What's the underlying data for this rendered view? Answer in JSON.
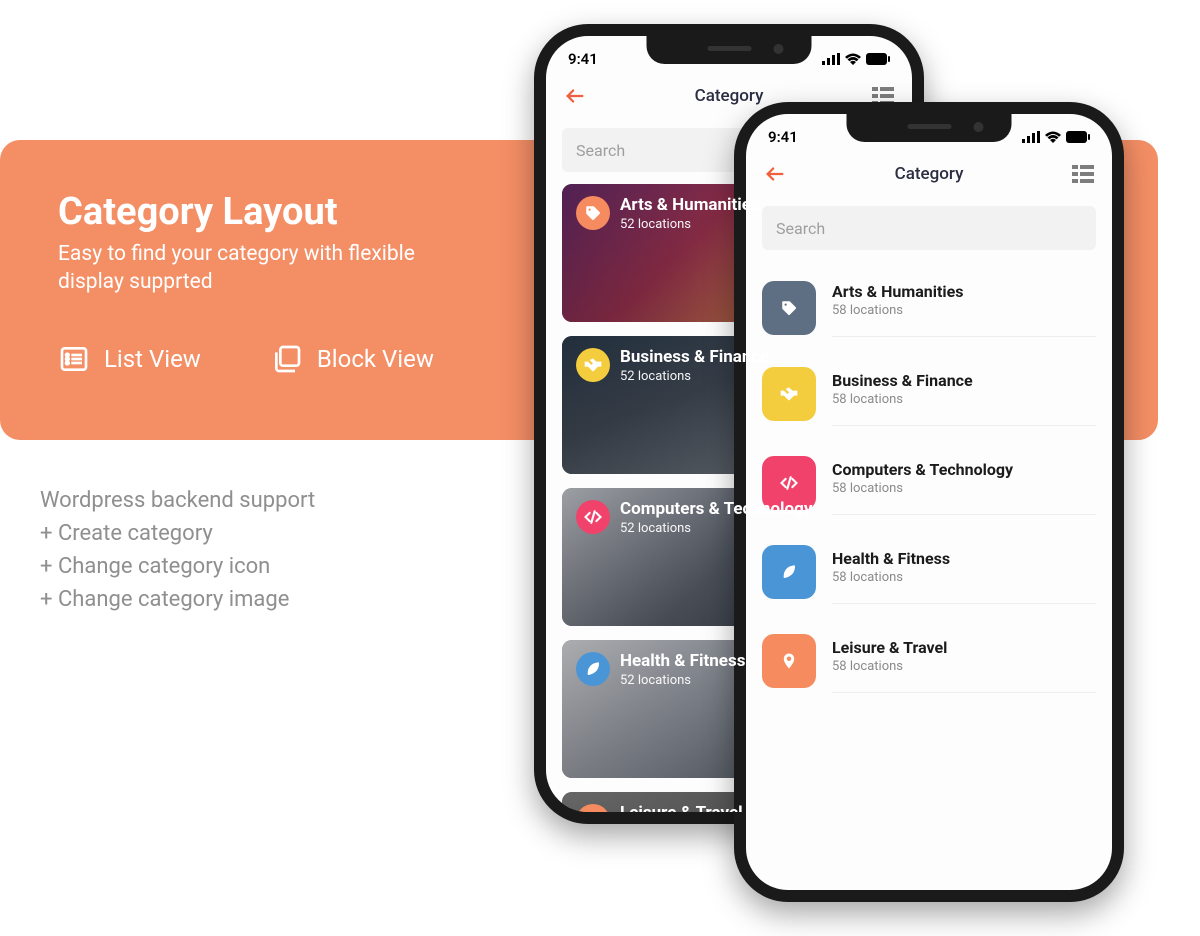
{
  "banner": {
    "title": "Category Layout",
    "subtitle": "Easy to find your category with flexible display supprted",
    "list_label": "List View",
    "block_label": "Block View"
  },
  "below": {
    "line1": "Wordpress backend support",
    "line2": "+ Create category",
    "line3": "+ Change category icon",
    "line4": "+ Change category image"
  },
  "status": {
    "time": "9:41"
  },
  "nav": {
    "title": "Category"
  },
  "search": {
    "placeholder": "Search"
  },
  "block_categories": [
    {
      "name": "Arts & Humanities",
      "sub": "52 locations",
      "color": "clr-orange",
      "bg": "bg-arts",
      "icon": "tag"
    },
    {
      "name": "Business & Finance",
      "sub": "52 locations",
      "color": "clr-yellow",
      "bg": "bg-biz",
      "icon": "handshake"
    },
    {
      "name": "Computers & Technology",
      "sub": "52 locations",
      "color": "clr-pink",
      "bg": "bg-comp",
      "icon": "code"
    },
    {
      "name": "Health & Fitness",
      "sub": "52 locations",
      "color": "clr-blue",
      "bg": "bg-heal",
      "icon": "leaf"
    },
    {
      "name": "Leisure & Travel",
      "sub": "",
      "color": "clr-orange",
      "bg": "bg-trav",
      "icon": "pin"
    }
  ],
  "list_categories": [
    {
      "name": "Arts & Humanities",
      "sub": "58 locations",
      "color": "clr-slate",
      "icon": "tag"
    },
    {
      "name": "Business & Finance",
      "sub": "58 locations",
      "color": "clr-yellow",
      "icon": "handshake"
    },
    {
      "name": "Computers & Technology",
      "sub": "58 locations",
      "color": "clr-pink",
      "icon": "code"
    },
    {
      "name": "Health & Fitness",
      "sub": "58 locations",
      "color": "clr-blue",
      "icon": "leaf"
    },
    {
      "name": "Leisure & Travel",
      "sub": "58 locations",
      "color": "clr-orange",
      "icon": "pin"
    }
  ]
}
